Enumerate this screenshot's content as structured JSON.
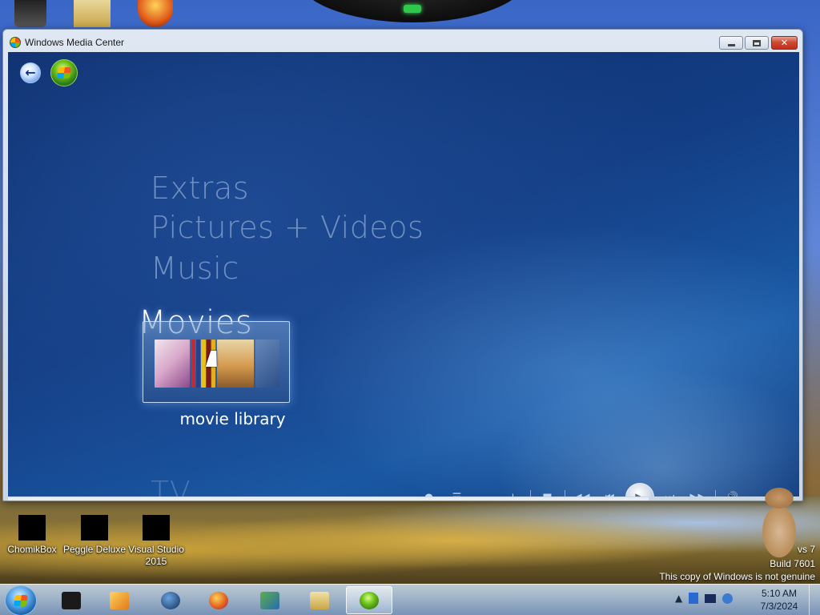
{
  "window": {
    "title": "Windows Media Center"
  },
  "media_center": {
    "menu": {
      "extras": "Extras",
      "pictures_videos": "Pictures + Videos",
      "music": "Music",
      "movies": "Movies",
      "tv": "TV"
    },
    "selected_tile": {
      "label": "movie library"
    },
    "transport": {
      "record": "●",
      "guide": "☰",
      "channel_down": "−",
      "channel_up": "+",
      "stop": "■",
      "rewind": "◀◀",
      "previous": "⏮",
      "play": "▶",
      "next": "⏭",
      "fast_forward": "▶▶",
      "mute": "🔊",
      "volume_down": "−",
      "volume_up": "+"
    }
  },
  "desktop": {
    "icons": [
      {
        "label": "ChomikBox"
      },
      {
        "label": "Peggle Deluxe"
      },
      {
        "label": "Visual Studio 2015"
      }
    ],
    "watermark": {
      "line1": "vs 7",
      "line2": "Build 7601",
      "line3": "This copy of Windows is not genuine"
    }
  },
  "taskbar": {
    "clock_time": "5:10 AM",
    "clock_date": "7/3/2024",
    "tray_arrow": "▲"
  },
  "colors": {
    "mc_background": "#133e85",
    "menu_dim": "#b4cdeb",
    "menu_focus": "#ffffff"
  }
}
